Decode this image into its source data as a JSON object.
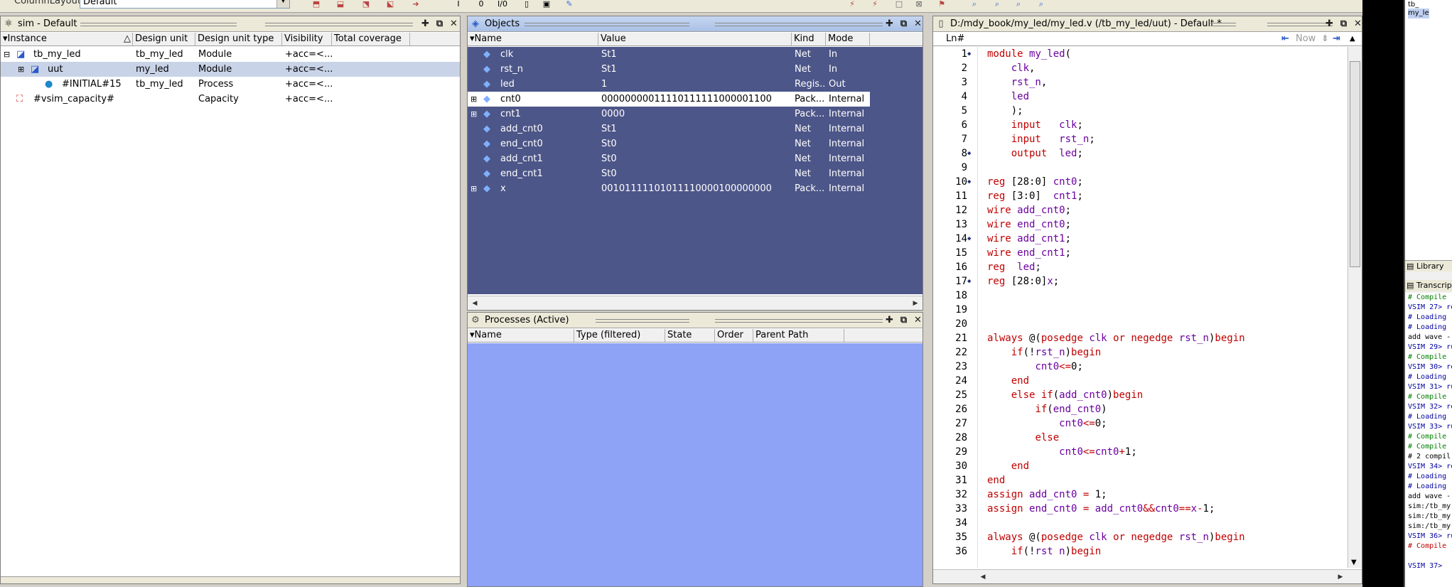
{
  "toolbar": {
    "layout_label": "ColumnLayout",
    "layout_value": "Default"
  },
  "sim_panel": {
    "title": "sim - Default",
    "columns": [
      "Instance",
      "Design unit",
      "Design unit type",
      "Visibility",
      "Total coverage"
    ],
    "rows": [
      {
        "expander": "−",
        "icon": "module-icon",
        "instance": "tb_my_led",
        "unit": "tb_my_led",
        "type": "Module",
        "visibility": "+acc=<...",
        "coverage": "",
        "indent": 0,
        "selected": false
      },
      {
        "expander": "+",
        "icon": "module-icon",
        "instance": "uut",
        "unit": "my_led",
        "type": "Module",
        "visibility": "+acc=<...",
        "coverage": "",
        "indent": 1,
        "selected": true
      },
      {
        "expander": "",
        "icon": "process-icon",
        "instance": "#INITIAL#15",
        "unit": "tb_my_led",
        "type": "Process",
        "visibility": "+acc=<...",
        "coverage": "",
        "indent": 2,
        "selected": false
      },
      {
        "expander": "",
        "icon": "capacity-icon",
        "instance": "#vsim_capacity#",
        "unit": "",
        "type": "Capacity",
        "visibility": "+acc=<...",
        "coverage": "",
        "indent": 0,
        "selected": false
      }
    ]
  },
  "objects_panel": {
    "title": "Objects",
    "columns": [
      "Name",
      "Value",
      "Kind",
      "Mode"
    ],
    "rows": [
      {
        "expander": "",
        "name": "clk",
        "value": "St1",
        "kind": "Net",
        "mode": "In",
        "selected": false
      },
      {
        "expander": "",
        "name": "rst_n",
        "value": "St1",
        "kind": "Net",
        "mode": "In",
        "selected": false
      },
      {
        "expander": "",
        "name": "led",
        "value": "1",
        "kind": "Regis...",
        "mode": "Out",
        "selected": false
      },
      {
        "expander": "+",
        "name": "cnt0",
        "value": "00000000011110111111000001100",
        "kind": "Pack...",
        "mode": "Internal",
        "selected": true
      },
      {
        "expander": "+",
        "name": "cnt1",
        "value": "0000",
        "kind": "Pack...",
        "mode": "Internal",
        "selected": false
      },
      {
        "expander": "",
        "name": "add_cnt0",
        "value": "St1",
        "kind": "Net",
        "mode": "Internal",
        "selected": false
      },
      {
        "expander": "",
        "name": "end_cnt0",
        "value": "St0",
        "kind": "Net",
        "mode": "Internal",
        "selected": false
      },
      {
        "expander": "",
        "name": "add_cnt1",
        "value": "St0",
        "kind": "Net",
        "mode": "Internal",
        "selected": false
      },
      {
        "expander": "",
        "name": "end_cnt1",
        "value": "St0",
        "kind": "Net",
        "mode": "Internal",
        "selected": false
      },
      {
        "expander": "+",
        "name": "x",
        "value": "00101111101011110000100000000",
        "kind": "Pack...",
        "mode": "Internal",
        "selected": false
      }
    ]
  },
  "processes_panel": {
    "title": "Processes (Active)",
    "columns": [
      "Name",
      "Type (filtered)",
      "State",
      "Order",
      "Parent Path"
    ]
  },
  "source_panel": {
    "title": "D:/mdy_book/my_led/my_led.v (/tb_my_led/uut) - Default *",
    "ln_header": "Ln#",
    "now_label": "Now",
    "lines": [
      {
        "n": "1",
        "mark": true,
        "text": "module my_led("
      },
      {
        "n": "2",
        "mark": false,
        "text": "    clk,"
      },
      {
        "n": "3",
        "mark": false,
        "text": "    rst_n,"
      },
      {
        "n": "4",
        "mark": false,
        "text": "    led"
      },
      {
        "n": "5",
        "mark": false,
        "text": "    );"
      },
      {
        "n": "6",
        "mark": false,
        "text": "    input   clk;"
      },
      {
        "n": "7",
        "mark": false,
        "text": "    input   rst_n;"
      },
      {
        "n": "8",
        "mark": true,
        "text": "    output  led;"
      },
      {
        "n": "9",
        "mark": false,
        "text": ""
      },
      {
        "n": "10",
        "mark": true,
        "text": "reg [28:0] cnt0;"
      },
      {
        "n": "11",
        "mark": false,
        "text": "reg [3:0]  cnt1;"
      },
      {
        "n": "12",
        "mark": false,
        "text": "wire add_cnt0;"
      },
      {
        "n": "13",
        "mark": false,
        "text": "wire end_cnt0;"
      },
      {
        "n": "14",
        "mark": true,
        "text": "wire add_cnt1;"
      },
      {
        "n": "15",
        "mark": false,
        "text": "wire end_cnt1;"
      },
      {
        "n": "16",
        "mark": false,
        "text": "reg  led;"
      },
      {
        "n": "17",
        "mark": true,
        "text": "reg [28:0]x;"
      },
      {
        "n": "18",
        "mark": false,
        "text": ""
      },
      {
        "n": "19",
        "mark": false,
        "text": ""
      },
      {
        "n": "20",
        "mark": false,
        "text": ""
      },
      {
        "n": "21",
        "mark": false,
        "text": "always @(posedge clk or negedge rst_n)begin"
      },
      {
        "n": "22",
        "mark": false,
        "text": "    if(!rst_n)begin"
      },
      {
        "n": "23",
        "mark": false,
        "text": "        cnt0<=0;"
      },
      {
        "n": "24",
        "mark": false,
        "text": "    end"
      },
      {
        "n": "25",
        "mark": false,
        "text": "    else if(add_cnt0)begin"
      },
      {
        "n": "26",
        "mark": false,
        "text": "        if(end_cnt0)"
      },
      {
        "n": "27",
        "mark": false,
        "text": "            cnt0<=0;"
      },
      {
        "n": "28",
        "mark": false,
        "text": "        else"
      },
      {
        "n": "29",
        "mark": false,
        "text": "            cnt0<=cnt0+1;"
      },
      {
        "n": "30",
        "mark": false,
        "text": "    end"
      },
      {
        "n": "31",
        "mark": false,
        "text": "end"
      },
      {
        "n": "32",
        "mark": false,
        "text": "assign add_cnt0 = 1;"
      },
      {
        "n": "33",
        "mark": false,
        "text": "assign end_cnt0 = add_cnt0&&cnt0==x-1;"
      },
      {
        "n": "34",
        "mark": false,
        "text": ""
      },
      {
        "n": "35",
        "mark": false,
        "text": "always @(posedge clk or negedge rst_n)begin"
      },
      {
        "n": "36",
        "mark": false,
        "text": "    if(!rst n)begin"
      }
    ]
  },
  "side_panel": {
    "tree_items": [
      "tb_",
      "my_le"
    ],
    "library_tab": "Library",
    "transcript_tab": "Transcript",
    "transcript": [
      {
        "cls": "tr-green",
        "text": "# Compile"
      },
      {
        "cls": "tr-blue",
        "text": "VSIM 27> re"
      },
      {
        "cls": "tr-blue",
        "text": "# Loading"
      },
      {
        "cls": "tr-blue",
        "text": "# Loading"
      },
      {
        "cls": "",
        "text": "add wave -"
      },
      {
        "cls": "tr-blue",
        "text": "VSIM 29> ru"
      },
      {
        "cls": "tr-green",
        "text": "# Compile"
      },
      {
        "cls": "tr-blue",
        "text": "VSIM 30> re"
      },
      {
        "cls": "tr-blue",
        "text": "# Loading"
      },
      {
        "cls": "tr-blue",
        "text": "VSIM 31> ru"
      },
      {
        "cls": "tr-green",
        "text": "# Compile"
      },
      {
        "cls": "tr-blue",
        "text": "VSIM 32> re"
      },
      {
        "cls": "tr-blue",
        "text": "# Loading"
      },
      {
        "cls": "tr-blue",
        "text": "VSIM 33> ru"
      },
      {
        "cls": "tr-green",
        "text": "# Compile"
      },
      {
        "cls": "tr-green",
        "text": "# Compile"
      },
      {
        "cls": "",
        "text": "# 2 compil"
      },
      {
        "cls": "tr-blue",
        "text": "VSIM 34> re"
      },
      {
        "cls": "tr-blue",
        "text": "# Loading"
      },
      {
        "cls": "tr-blue",
        "text": "# Loading"
      },
      {
        "cls": "",
        "text": "add wave -"
      },
      {
        "cls": "",
        "text": "sim:/tb_my"
      },
      {
        "cls": "",
        "text": "sim:/tb_my"
      },
      {
        "cls": "",
        "text": "sim:/tb_my"
      },
      {
        "cls": "tr-blue",
        "text": "VSIM 36> ru"
      },
      {
        "cls": "tr-red",
        "text": "# Compile"
      },
      {
        "cls": "",
        "text": ""
      },
      {
        "cls": "tr-blue",
        "text": "VSIM 37>"
      }
    ]
  }
}
